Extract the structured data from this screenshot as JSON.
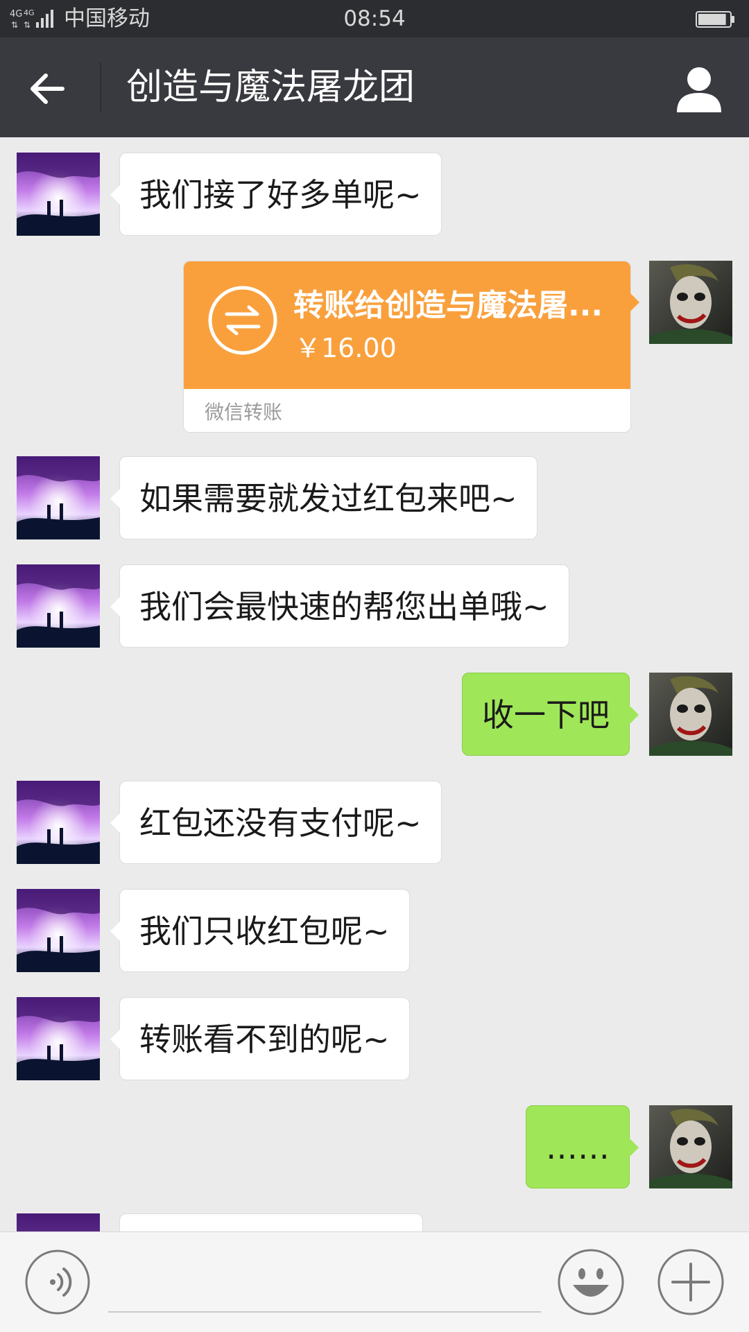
{
  "status_bar": {
    "network": "4G 4G",
    "carrier": "中国移动",
    "time": "08:54",
    "battery_level": 0.9
  },
  "header": {
    "title": "创造与魔法屠龙团"
  },
  "messages": [
    {
      "side": "left",
      "type": "text",
      "text": "我们接了好多单呢~"
    },
    {
      "side": "right",
      "type": "transfer",
      "title": "转账给创造与魔法屠...",
      "amount": "￥16.00",
      "footer": "微信转账"
    },
    {
      "side": "left",
      "type": "text",
      "text": "如果需要就发过红包来吧~"
    },
    {
      "side": "left",
      "type": "text",
      "text": "我们会最快速的帮您出单哦~"
    },
    {
      "side": "right",
      "type": "text",
      "text": "收一下吧"
    },
    {
      "side": "left",
      "type": "text",
      "text": "红包还没有支付呢~"
    },
    {
      "side": "left",
      "type": "text",
      "text": "我们只收红包呢~"
    },
    {
      "side": "left",
      "type": "text",
      "text": "转账看不到的呢~"
    },
    {
      "side": "right",
      "type": "text",
      "text": "……"
    },
    {
      "side": "left",
      "type": "text",
      "text": ""
    }
  ],
  "colors": {
    "titlebar": "#393a3f",
    "statusbar": "#2b2d31",
    "chat_background": "#ebebeb",
    "incoming_bubble": "#ffffff",
    "outgoing_bubble": "#9fe658",
    "transfer_card": "#f9a03d"
  },
  "icons": {
    "back": "arrow-left-icon",
    "profile": "person-icon",
    "voice": "voice-icon",
    "emoji": "smiley-icon",
    "more": "plus-icon",
    "transfer": "transfer-arrows-icon"
  }
}
